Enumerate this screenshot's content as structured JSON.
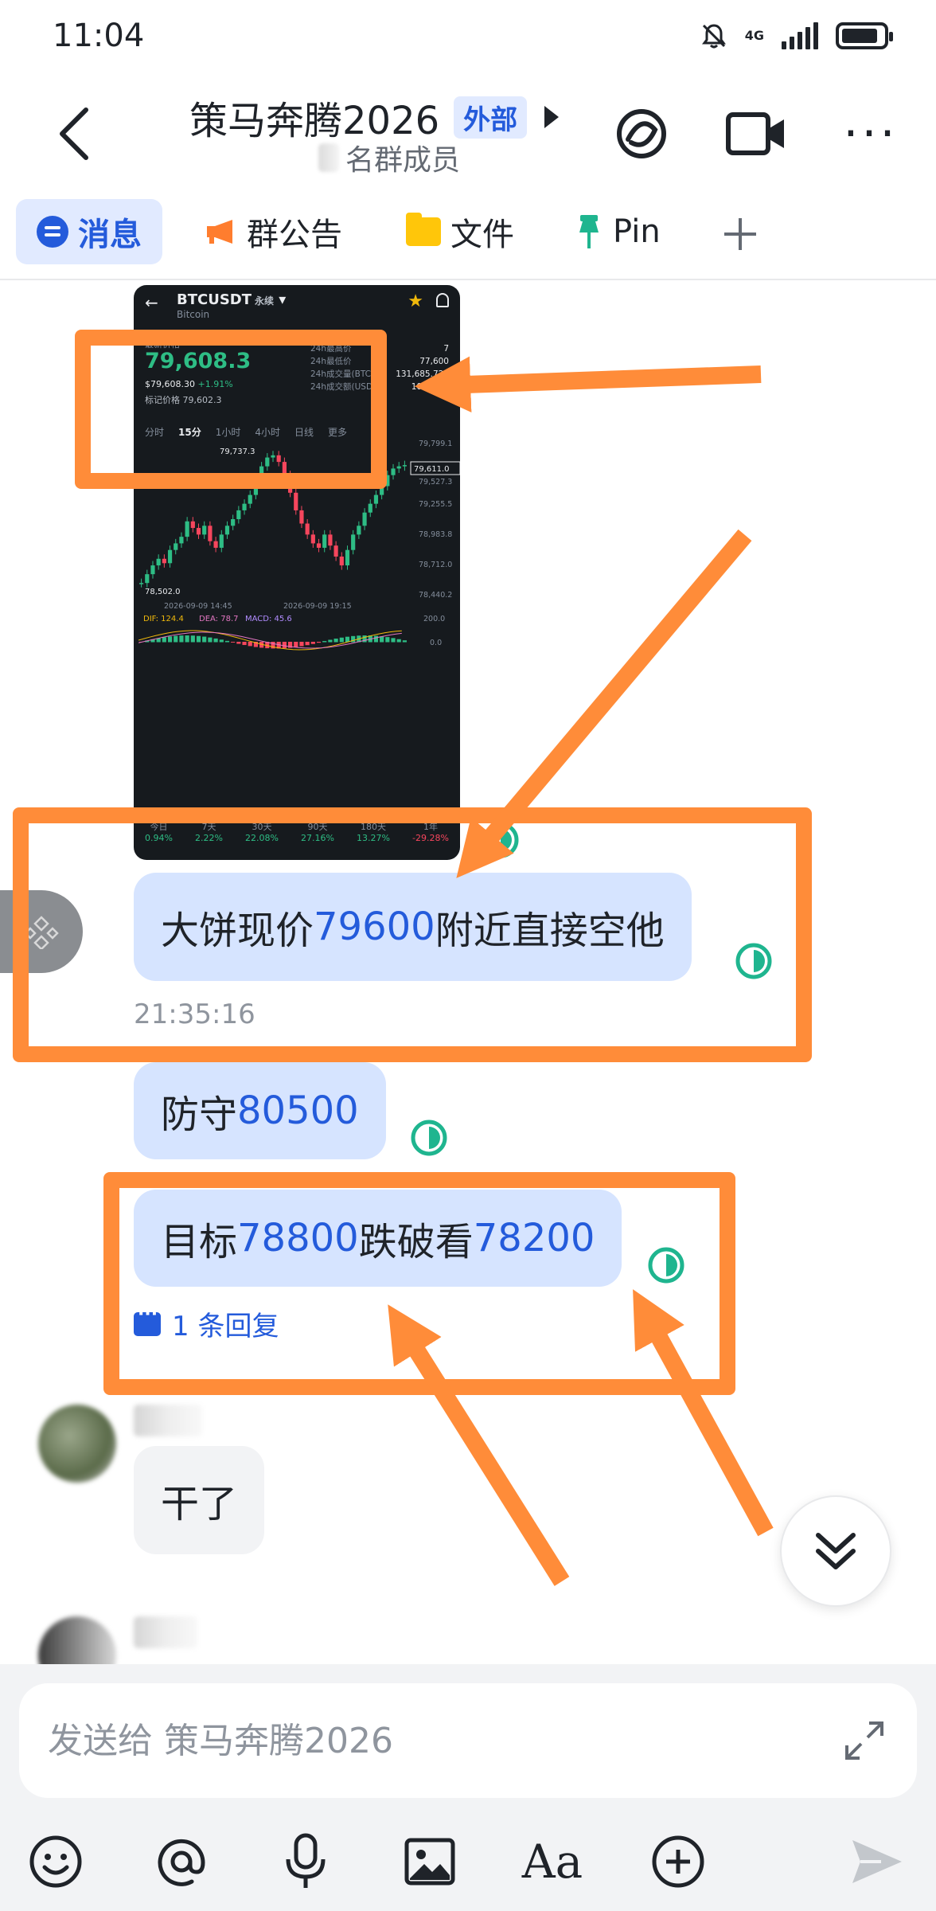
{
  "status_bar": {
    "time": "11:04",
    "network": "4G"
  },
  "header": {
    "title": "策马奔腾2026",
    "badge": "外部",
    "member_count_suffix": "名群成员"
  },
  "tabs": [
    {
      "label": "消息",
      "icon": "message-icon",
      "active": true
    },
    {
      "label": "群公告",
      "icon": "announcement-icon",
      "active": false
    },
    {
      "label": "文件",
      "icon": "folder-icon",
      "active": false
    },
    {
      "label": "Pin",
      "icon": "pin-icon",
      "active": false
    }
  ],
  "chart_screenshot": {
    "pair": "BTCUSDT",
    "contract_type": "永续",
    "coin_name": "Bitcoin",
    "price_label": "最新价格",
    "last_price": "79,608.3",
    "usd_price": "$79,608.30",
    "change": "+1.91%",
    "mark_price": "标记价格 79,602.3",
    "stats_labels": [
      "24h最高价",
      "24h最低价",
      "24h成交量(BTC)",
      "24h成交额(USDT)"
    ],
    "stats_values": [
      "7",
      "77,600",
      "131,685.722",
      "103.74亿"
    ],
    "intervals": [
      "分时",
      "15分",
      "1小时",
      "4小时",
      "日线",
      "更多"
    ],
    "active_interval": "15分",
    "high_label": "79,737.3",
    "low_label": "78,502.0",
    "current_tag": "79,611.0",
    "axis_prices": [
      "79,799.1",
      "79,527.3",
      "79,255.5",
      "78,983.8",
      "78,712.0",
      "78,440.2"
    ],
    "time_labels": [
      "2026-09-09 14:45",
      "2026-09-09 19:15"
    ],
    "macd_label_dif": "DIF: 124.4",
    "macd_label_dea": "DEA: 78.7",
    "macd_label_macd": "MACD: 45.6",
    "macd_axis": [
      "200.0",
      "0.0"
    ],
    "periods": [
      "今日",
      "7天",
      "30天",
      "90天",
      "180天",
      "1年"
    ],
    "period_changes": [
      "0.94%",
      "2.22%",
      "22.08%",
      "27.16%",
      "13.27%",
      "-29.28%"
    ],
    "colors": {
      "up": "#2ebd85",
      "down": "#f6465d",
      "bg": "#161a1e"
    }
  },
  "messages": [
    {
      "prefix": "大饼现价",
      "number": "79600",
      "suffix": "附近直接空他"
    },
    {
      "prefix": "防守",
      "number": "80500",
      "suffix": ""
    },
    {
      "prefix": "目标",
      "number": "78800",
      "middle": "跌破看",
      "number2": "78200"
    }
  ],
  "timestamp": "21:35:16",
  "reply_link": "1 条回复",
  "other_message": "干了",
  "composer": {
    "placeholder": "发送给 策马奔腾2026"
  },
  "toolbar_icons": [
    "emoji-icon",
    "mention-icon",
    "microphone-icon",
    "image-icon",
    "text-format-icon",
    "plus-circle-icon",
    "send-icon"
  ],
  "toolbar_text_format_label": "Aa",
  "colors": {
    "accent": "#245bdb",
    "bubble": "#d6e4ff",
    "annotation": "#ff8c39",
    "read_receipt": "#1fb58f"
  }
}
